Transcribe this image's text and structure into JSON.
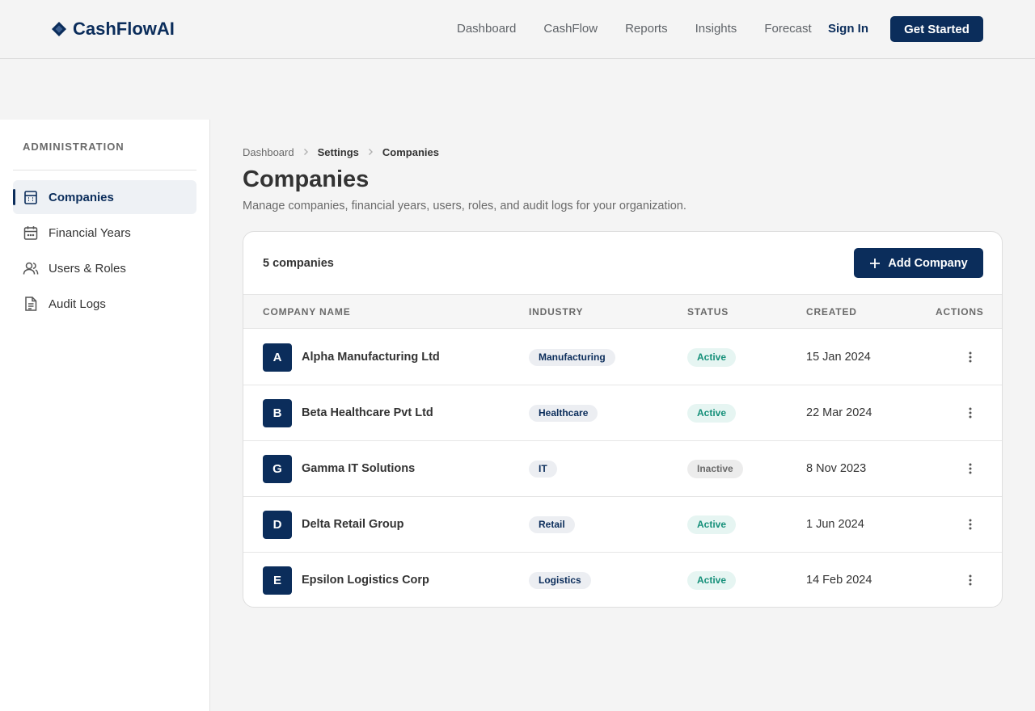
{
  "app": {
    "name": "CashFlowAI"
  },
  "nav": {
    "links": [
      "Dashboard",
      "CashFlow",
      "Reports",
      "Insights",
      "Forecast"
    ],
    "sign_in": "Sign In",
    "get_started": "Get Started"
  },
  "sidebar": {
    "title": "ADMINISTRATION",
    "items": [
      {
        "label": "Companies",
        "icon": "building-icon",
        "active": true
      },
      {
        "label": "Financial Years",
        "icon": "calendar-icon",
        "active": false
      },
      {
        "label": "Users & Roles",
        "icon": "users-icon",
        "active": false
      },
      {
        "label": "Audit Logs",
        "icon": "document-icon",
        "active": false
      }
    ]
  },
  "breadcrumb": [
    "Dashboard",
    "Settings",
    "Companies"
  ],
  "page": {
    "title": "Companies",
    "subtitle": "Manage companies, financial years, users, roles, and audit logs for your organization."
  },
  "table": {
    "count_label": "5 companies",
    "add_label": "Add Company",
    "columns": [
      "COMPANY NAME",
      "INDUSTRY",
      "STATUS",
      "CREATED",
      "ACTIONS"
    ],
    "rows": [
      {
        "initial": "A",
        "name": "Alpha Manufacturing Ltd",
        "industry": "Manufacturing",
        "status": "Active",
        "created": "15 Jan 2024"
      },
      {
        "initial": "B",
        "name": "Beta Healthcare Pvt Ltd",
        "industry": "Healthcare",
        "status": "Active",
        "created": "22 Mar 2024"
      },
      {
        "initial": "G",
        "name": "Gamma IT Solutions",
        "industry": "IT",
        "status": "Inactive",
        "created": "8 Nov 2023"
      },
      {
        "initial": "D",
        "name": "Delta Retail Group",
        "industry": "Retail",
        "status": "Active",
        "created": "1 Jun 2024"
      },
      {
        "initial": "E",
        "name": "Epsilon Logistics Corp",
        "industry": "Logistics",
        "status": "Active",
        "created": "14 Feb 2024"
      }
    ]
  },
  "colors": {
    "brand": "#0b2d5b",
    "active_status": "#16907a"
  }
}
